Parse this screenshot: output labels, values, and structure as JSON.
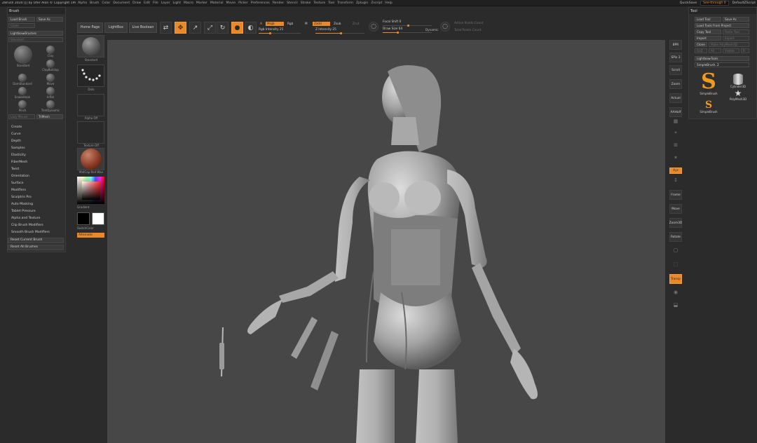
{
  "titlebar": {
    "app_title": "ZBrush 2020 [|] by Ofer Alon © Copyright 1997-2020 Pixologic, Inc.",
    "menus": [
      "Alpha",
      "Brush",
      "Color",
      "Document",
      "Draw",
      "Edit",
      "File",
      "Layer",
      "Light",
      "Macro",
      "Marker",
      "Material",
      "Movie",
      "Picker",
      "Preferences",
      "Render",
      "Stencil",
      "Stroke",
      "Texture",
      "Tool",
      "Transform",
      "Zplugin",
      "Zscript",
      "Help"
    ],
    "quicksave": "QuickSave",
    "see_through": "See-through 0",
    "default_script": "DefaultZScript"
  },
  "top_shelf": {
    "home_page": "Home Page",
    "lightbox": "LightBox",
    "live_boolean": "Live Boolean",
    "a_label": "A",
    "mrgb": "Mrgb",
    "rgb": "Rgb",
    "m": "M",
    "zadd": "Zadd",
    "zsub": "Zsub",
    "zcut": "Zcut",
    "rgb_intensity": "Rgb Intensity 25",
    "z_intensity": "Z Intensity 25",
    "focal_shift": "Focal Shift 0",
    "draw_size": "Draw Size 64",
    "dynamic": "Dynamic",
    "active_points": "Active Points Count",
    "total_points": "Total Points Count",
    "rgb_intensity_value": 25,
    "z_intensity_value": 25,
    "draw_size_fraction": 0.1
  },
  "brush_palette": {
    "title": "Brush",
    "load_brush": "Load Brush",
    "save_as": "Save As",
    "clone": "Clone",
    "lightbox_brushes": "Lightbox▸Brushes",
    "standard": "Standard",
    "brushes": [
      {
        "label": "Standard"
      },
      {
        "label": "Clay"
      },
      {
        "label": "ClayBuildup"
      },
      {
        "label": "DamStandard"
      },
      {
        "label": "Move"
      },
      {
        "label": "SnakeHook"
      },
      {
        "label": "Inflat"
      },
      {
        "label": "Pinch"
      },
      {
        "label": "TrimDynamic"
      },
      {
        "label": "hPolish"
      }
    ],
    "lazy_mouse": "Lazy Mouse",
    "tri_mesh": "TriMesh",
    "subpalettes": [
      "Create",
      "Curve",
      "Depth",
      "Samples",
      "Elasticity",
      "FiberMesh",
      "Twist",
      "Orientation",
      "Surface",
      "Modifiers",
      "Sculptris Pro",
      "Auto Masking",
      "Tablet Pressure",
      "Alpha and Texture",
      "Clip Brush Modifiers",
      "Smooth Brush Modifiers"
    ],
    "reset_current": "Reset Current Brush",
    "reset_all": "Reset All Brushes"
  },
  "left_shelf": {
    "standard": "Standard",
    "dots": "Dots",
    "alpha_off": "Alpha Off",
    "texture_off": "Texture Off",
    "matcap": "MatCap Red Wax",
    "gradient": "Gradient",
    "switch_color": "SwitchColor",
    "alternate": "Alternate"
  },
  "right_shelf": {
    "bpr": "BPR",
    "spix": "SPix 3",
    "scroll": "Scroll",
    "zoom": "Zoom",
    "actual": "Actual",
    "aahalf": "AAHalf",
    "persp": "Persp",
    "floor": "Floor",
    "local": "Local",
    "xyz": "Xyz",
    "frame": "Frame",
    "move": "Move",
    "zoom3d": "Zoom3D",
    "rotate": "Rotate",
    "polyf": "PolyF",
    "transp": "Transp",
    "solo": "Solo",
    "xpose": "Xpose"
  },
  "tool_palette": {
    "title": "Tool",
    "load_tool": "Load Tool",
    "save_as": "Save As",
    "load_tools_from_project": "Load Tools From Project",
    "copy_tool": "Copy Tool",
    "paste_tool": "Paste Tool",
    "import": "Import",
    "export": "Export",
    "clone": "Clone",
    "make_polymesh": "Make PolyMesh3D",
    "goz": "GoZ",
    "all": "All",
    "visible": "Visible",
    "r": "R",
    "lightbox_tools": "Lightbox▸Tools",
    "simplebrush_label": "SimpleBrush. 2",
    "thumbs": [
      {
        "label": "SimpleBrush"
      },
      {
        "label": "Cylinder3D"
      },
      {
        "label": "PolyMesh3D"
      },
      {
        "label": "SimpleBrush"
      }
    ]
  },
  "colors": {
    "accent": "#e9892a",
    "background": "#2b2b2b",
    "viewport": "#474747"
  }
}
